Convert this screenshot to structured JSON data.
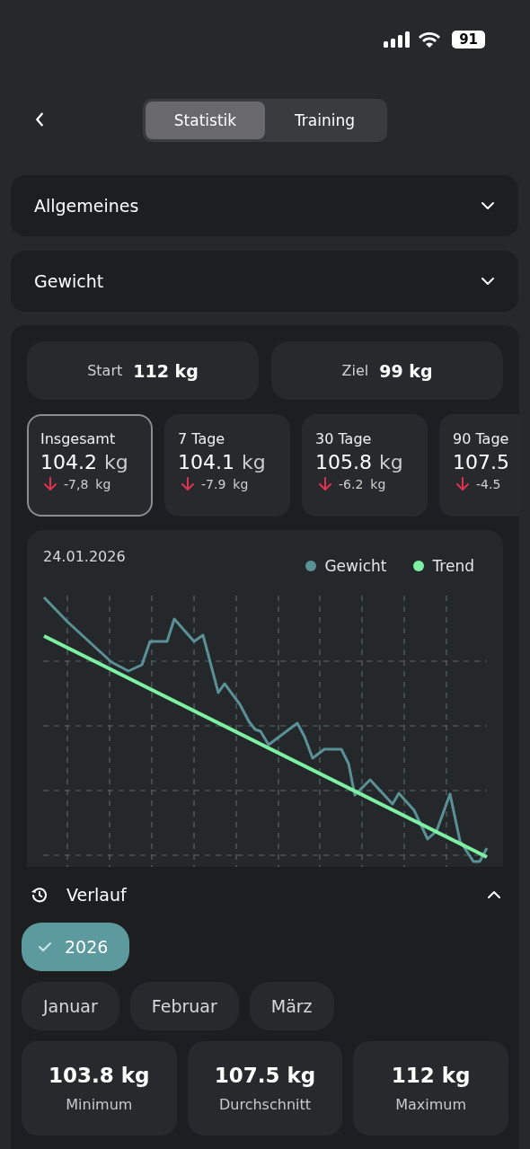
{
  "status_bar": {
    "battery": "91"
  },
  "tabs": [
    {
      "label": "Statistik",
      "selected": true
    },
    {
      "label": "Training",
      "selected": false
    }
  ],
  "sections": [
    {
      "title": "Allgemeines",
      "expanded": false
    },
    {
      "title": "Gewicht",
      "expanded": false
    }
  ],
  "goals": [
    {
      "label": "Start",
      "value": "112 kg"
    },
    {
      "label": "Ziel",
      "value": "99 kg"
    }
  ],
  "periods": [
    {
      "label": "Insgesamt",
      "value": "104.2",
      "unit": "kg",
      "change": "-7,8",
      "change_unit": "kg",
      "selected": true
    },
    {
      "label": "7 Tage",
      "value": "104.1",
      "unit": "kg",
      "change": "-7.9",
      "change_unit": "kg",
      "selected": false
    },
    {
      "label": "30 Tage",
      "value": "105.8",
      "unit": "kg",
      "change": "-6.2",
      "change_unit": "kg",
      "selected": false
    },
    {
      "label": "90 Tage",
      "value": "107.5",
      "change": "-4.5",
      "selected": false
    }
  ],
  "chart": {
    "date": "24.01.2026",
    "legend": [
      {
        "label": "Gewicht",
        "color": "#5a9196"
      },
      {
        "label": "Trend",
        "color": "#7df0a4"
      }
    ]
  },
  "history": {
    "title": "Verlauf",
    "expanded": true,
    "years": [
      {
        "label": "2026",
        "selected": true
      }
    ],
    "months": [
      {
        "label": "Januar",
        "selected": false
      },
      {
        "label": "Februar",
        "selected": false
      },
      {
        "label": "März",
        "selected": false
      }
    ],
    "stats": [
      {
        "value": "103.8 kg",
        "label": "Minimum"
      },
      {
        "value": "107.5 kg",
        "label": "Durchschnitt"
      },
      {
        "value": "112 kg",
        "label": "Maximum"
      }
    ]
  }
}
